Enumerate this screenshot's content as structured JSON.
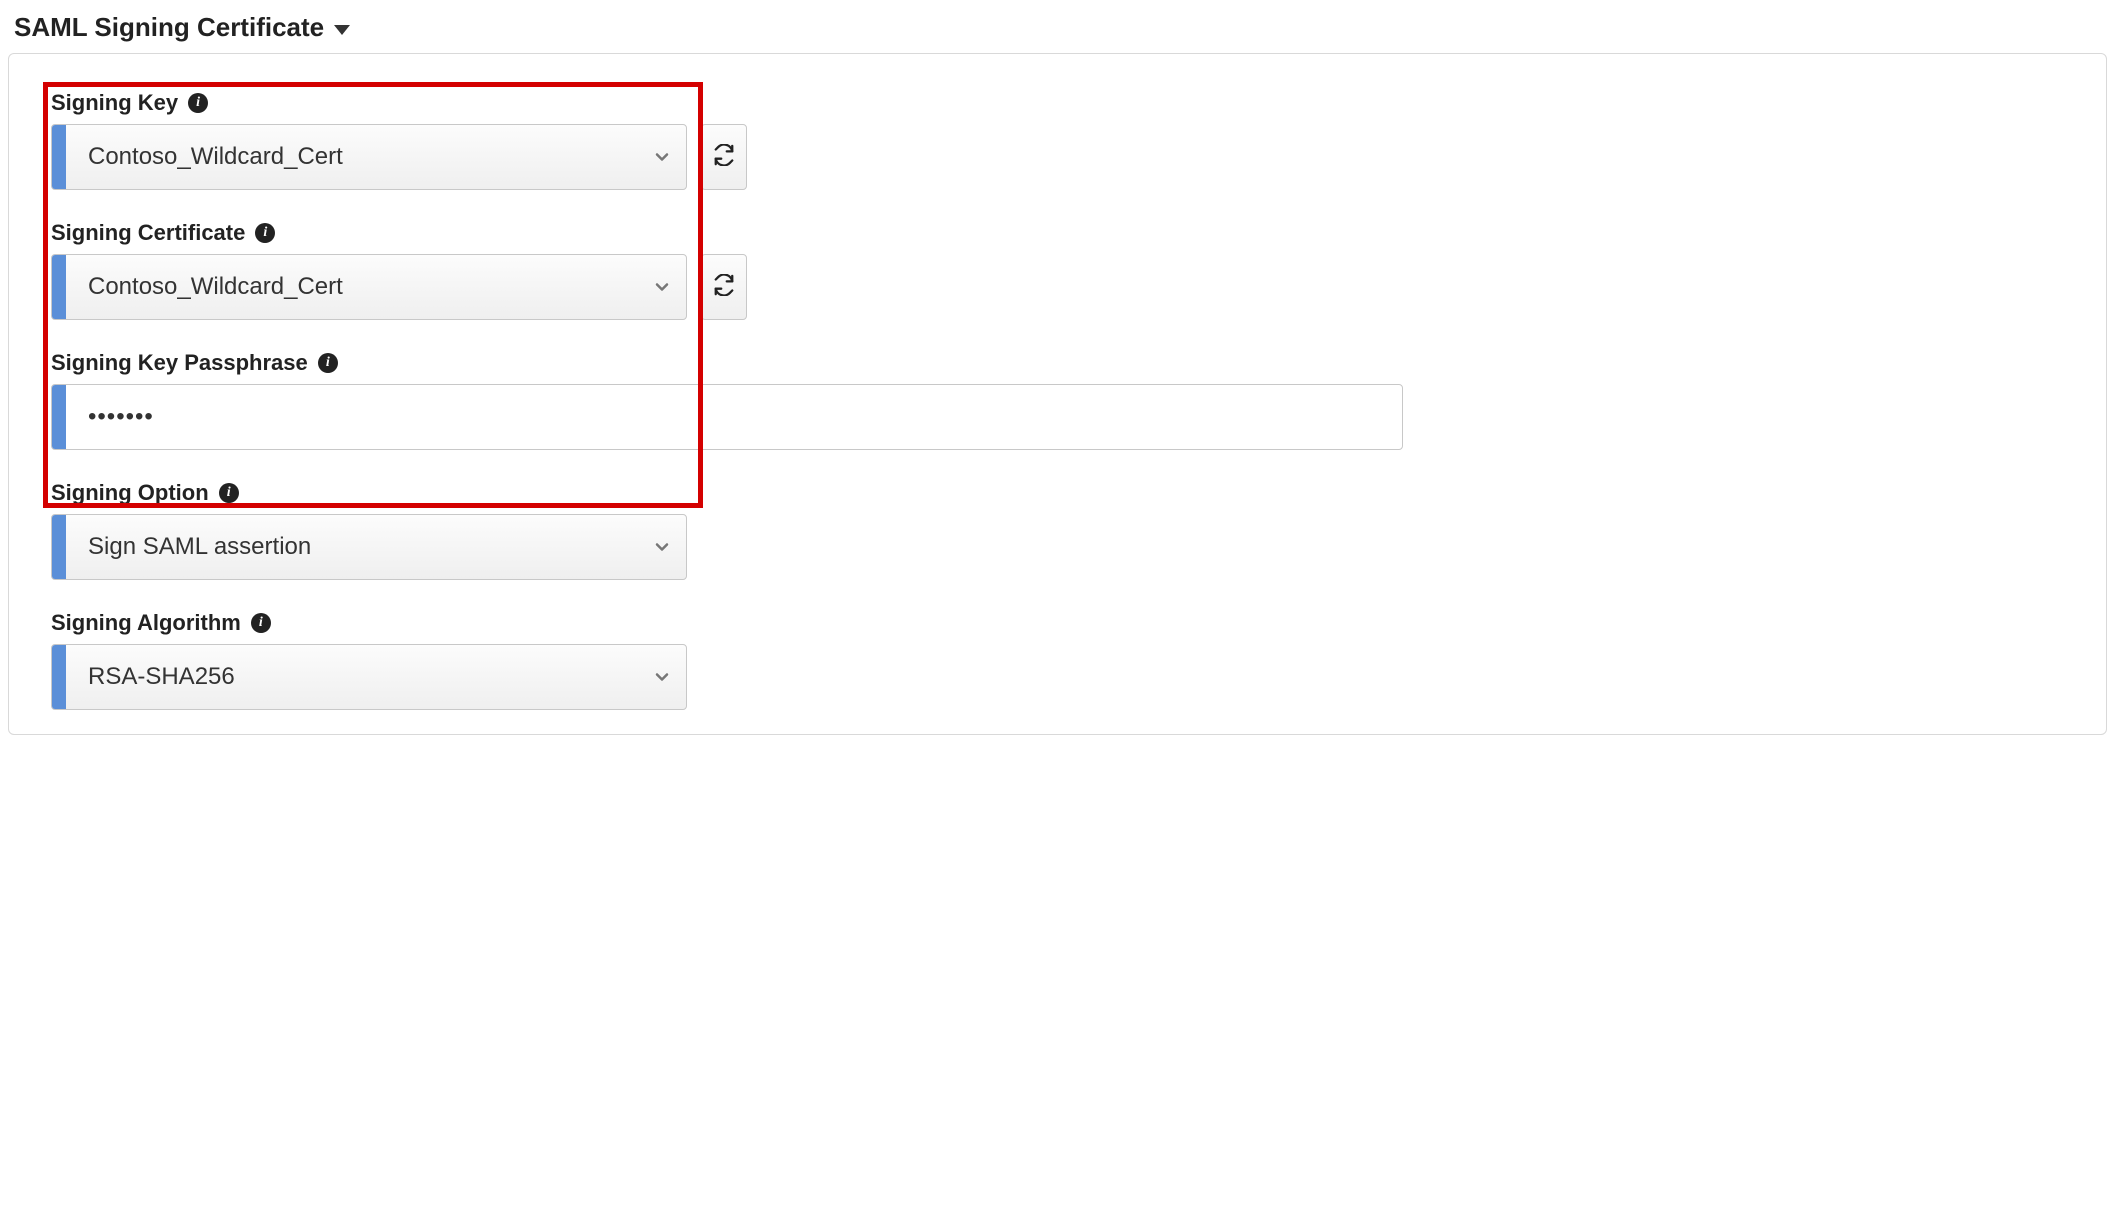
{
  "section": {
    "title": "SAML Signing Certificate"
  },
  "fields": {
    "signing_key": {
      "label": "Signing Key",
      "value": "Contoso_Wildcard_Cert"
    },
    "signing_certificate": {
      "label": "Signing Certificate",
      "value": "Contoso_Wildcard_Cert"
    },
    "signing_key_passphrase": {
      "label": "Signing Key Passphrase",
      "value": "•••••••"
    },
    "signing_option": {
      "label": "Signing Option",
      "value": "Sign SAML assertion"
    },
    "signing_algorithm": {
      "label": "Signing Algorithm",
      "value": "RSA-SHA256"
    }
  },
  "icons": {
    "info": "i"
  }
}
